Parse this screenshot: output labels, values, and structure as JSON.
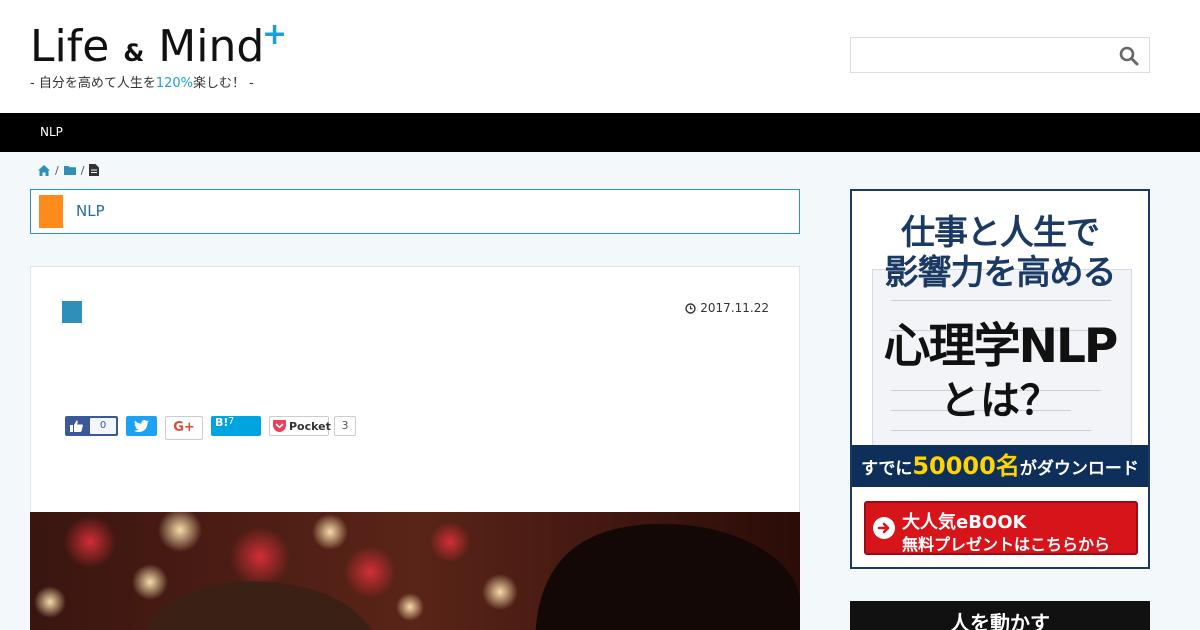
{
  "header": {
    "logo": {
      "life": "Life",
      "amp": "&",
      "mind": "Mind",
      "plus": "+"
    },
    "tagline_pre": "- 自分を高めて人生を",
    "tagline_highlight": "120%",
    "tagline_post": "楽しむ！ -",
    "search": {
      "value": "",
      "placeholder": ""
    }
  },
  "nav": {
    "items": [
      {
        "label": "NLP"
      }
    ]
  },
  "breadcrumb": {
    "sep": "/",
    "icons": [
      "home-icon",
      "folder-icon",
      "file-icon"
    ]
  },
  "category_heading": {
    "label": "NLP",
    "accent_color": "#ff8c1a"
  },
  "article": {
    "date": "2017.11.22",
    "share": {
      "facebook_count": "0",
      "google_plus": "G+",
      "hatena_label": "B!",
      "hatena_count": "7",
      "pocket_label": "Pocket",
      "pocket_count": "3"
    }
  },
  "sidebar": {
    "banner1": {
      "line1": "仕事と人生で",
      "line2": "影響力を高める",
      "line3": "心理学NLP",
      "line4": "とは？",
      "strip_pre": "すでに",
      "strip_num": "50000名",
      "strip_post": "がダウンロード",
      "cta_line1": "大人気eBOOK",
      "cta_line2": "無料プレゼントはこちらから"
    },
    "banner2": {
      "text": "人を動かす"
    }
  },
  "colors": {
    "accent": "#1aa0d8",
    "nav_bg": "#000000",
    "category_border": "#2f8fb8"
  }
}
